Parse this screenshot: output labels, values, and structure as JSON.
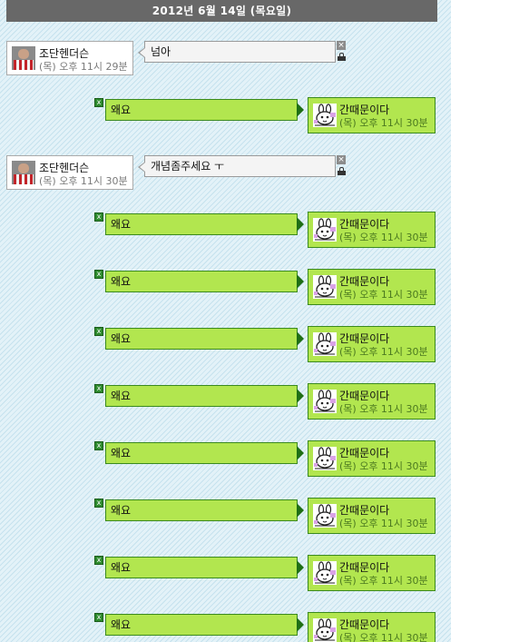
{
  "date_header": "2012년 6월 14일 (목요일)",
  "colors": {
    "date_bar": "#686868",
    "my_bubble": "#b2e64f",
    "my_bubble_border": "#3b8a1e",
    "their_bubble": "#f4f4f4",
    "background": "#dceef7"
  },
  "delete_mark": "×",
  "my_delete_mark": "x",
  "other_user": {
    "name": "조단헨더슨",
    "avatar_icon": "footballer-photo-avatar"
  },
  "me": {
    "name": "간때문이다",
    "avatar_icon": "cartoon-bunny-avatar"
  },
  "messages": [
    {
      "from": "other",
      "text": "넘아",
      "time": "(목) 오후 11시 29분"
    },
    {
      "from": "me",
      "text": "왜요",
      "time": "(목) 오후 11시 30분"
    },
    {
      "from": "other",
      "text": "개념좀주세요 ㅜ",
      "time": "(목) 오후 11시 30분"
    },
    {
      "from": "me",
      "text": "왜요",
      "time": "(목) 오후 11시 30분"
    },
    {
      "from": "me",
      "text": "왜요",
      "time": "(목) 오후 11시 30분"
    },
    {
      "from": "me",
      "text": "왜요",
      "time": "(목) 오후 11시 30분"
    },
    {
      "from": "me",
      "text": "왜요",
      "time": "(목) 오후 11시 30분"
    },
    {
      "from": "me",
      "text": "왜요",
      "time": "(목) 오후 11시 30분"
    },
    {
      "from": "me",
      "text": "왜요",
      "time": "(목) 오후 11시 30분"
    },
    {
      "from": "me",
      "text": "왜요",
      "time": "(목) 오후 11시 30분"
    },
    {
      "from": "me",
      "text": "왜요",
      "time": "(목) 오후 11시 30분"
    }
  ]
}
